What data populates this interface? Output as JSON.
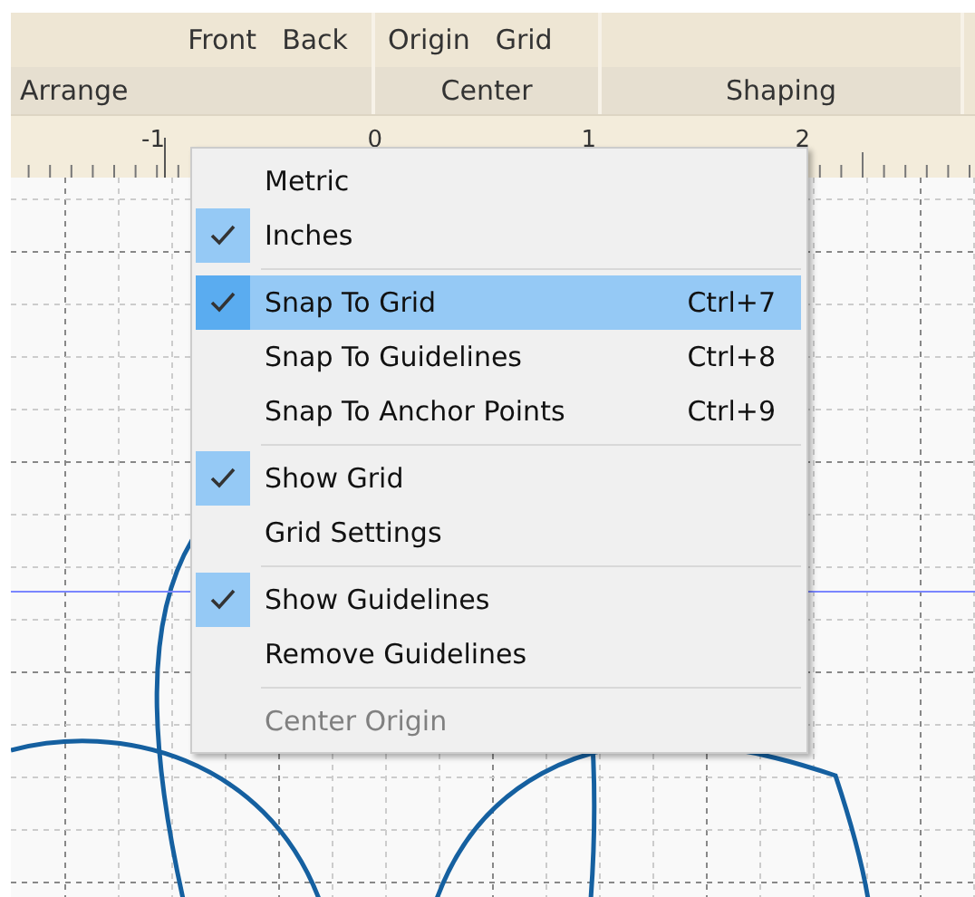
{
  "ribbon": {
    "groups": [
      {
        "label": "Arrange",
        "buttons": [
          "Front",
          "Back"
        ]
      },
      {
        "label": "Center",
        "buttons": [
          "Origin",
          "Grid"
        ]
      },
      {
        "label": "Shaping"
      }
    ]
  },
  "ruler": {
    "labels": [
      "-1",
      "0",
      "1",
      "2"
    ]
  },
  "menu": {
    "items": [
      {
        "kind": "item",
        "label": "Metric",
        "checked": false,
        "selected": false,
        "disabled": false
      },
      {
        "kind": "item",
        "label": "Inches",
        "checked": true,
        "selected": false,
        "disabled": false
      },
      {
        "kind": "separator"
      },
      {
        "kind": "item",
        "label": "Snap To Grid",
        "shortcut": "Ctrl+7",
        "checked": true,
        "selected": true,
        "disabled": false
      },
      {
        "kind": "item",
        "label": "Snap To Guidelines",
        "shortcut": "Ctrl+8",
        "checked": false,
        "selected": false,
        "disabled": false
      },
      {
        "kind": "item",
        "label": "Snap To Anchor Points",
        "shortcut": "Ctrl+9",
        "checked": false,
        "selected": false,
        "disabled": false
      },
      {
        "kind": "separator"
      },
      {
        "kind": "item",
        "label": "Show Grid",
        "checked": true,
        "selected": false,
        "disabled": false
      },
      {
        "kind": "item",
        "label": "Grid Settings",
        "checked": false,
        "selected": false,
        "disabled": false
      },
      {
        "kind": "separator"
      },
      {
        "kind": "item",
        "label": "Show Guidelines",
        "checked": true,
        "selected": false,
        "disabled": false
      },
      {
        "kind": "item",
        "label": "Remove Guidelines",
        "checked": false,
        "selected": false,
        "disabled": false
      },
      {
        "kind": "separator"
      },
      {
        "kind": "item",
        "label": "Center Origin",
        "checked": false,
        "selected": false,
        "disabled": true
      }
    ]
  }
}
